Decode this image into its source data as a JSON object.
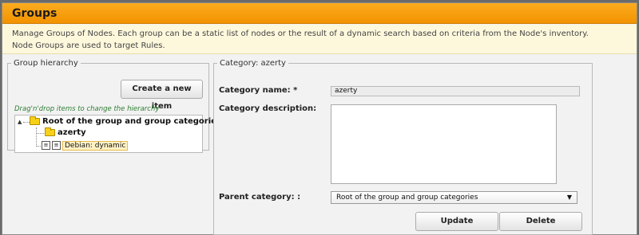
{
  "header": {
    "title": "Groups"
  },
  "description": {
    "line1": "Manage Groups of Nodes. Each group can be a static list of nodes or the result of a dynamic search based on criteria from the Node's inventory.",
    "line2": "Node Groups are used to target Rules."
  },
  "hierarchy": {
    "legend": "Group hierarchy",
    "create_button": "Create a new item",
    "hint": "Drag'n'drop items to change the hierarchy",
    "tree": {
      "root_label": "Root of the group and group categories",
      "children": [
        {
          "label": "azerty",
          "icon": "folder-icon"
        },
        {
          "label": "Debian: dynamic",
          "icon": "group-icon"
        }
      ]
    }
  },
  "category_form": {
    "legend": "Category: azerty",
    "name_label": "Category name: *",
    "name_value": "azerty",
    "description_label": "Category description:",
    "description_value": "",
    "parent_label": "Parent category: :",
    "parent_value": "Root of the group and group categories",
    "update_button": "Update",
    "delete_button": "Delete"
  },
  "colors": {
    "accent": "#f39200",
    "description_bg": "#fdf8dc",
    "hint_text": "#2e7d32"
  }
}
